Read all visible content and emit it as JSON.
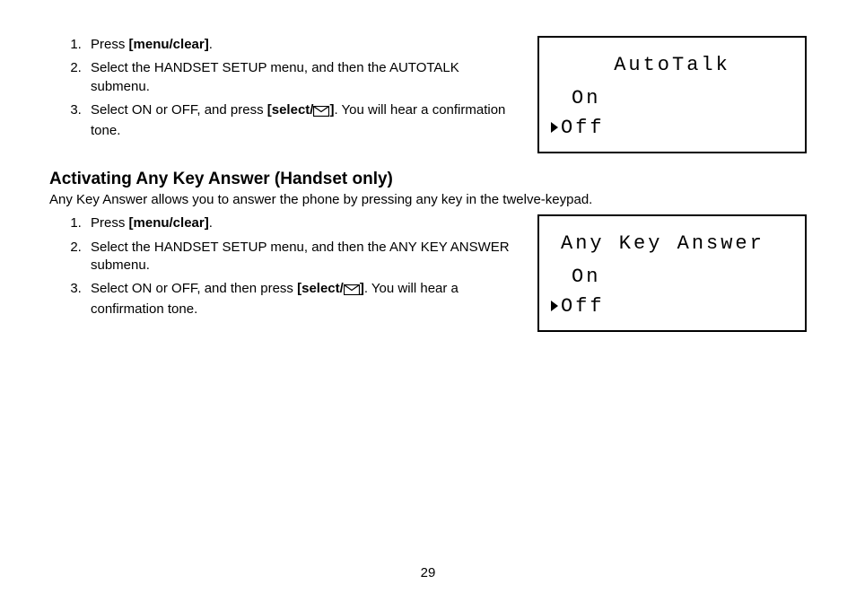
{
  "page_number": "29",
  "section1": {
    "steps": [
      {
        "prefix": "Press ",
        "bold": "[menu/clear]",
        "suffix": "."
      },
      {
        "text": "Select the HANDSET SETUP menu, and then the AUTOTALK submenu."
      },
      {
        "prefix": "Select ON or OFF, and press ",
        "bold_open": "[select/",
        "bold_close": "]",
        "suffix": ". You will hear a confirmation tone."
      }
    ],
    "lcd": {
      "title": "AutoTalk",
      "option1": "On",
      "option2": "Off"
    }
  },
  "section2": {
    "heading": "Activating Any Key Answer (Handset only)",
    "description": "Any Key Answer allows you to answer the phone by pressing any key in the twelve-keypad.",
    "steps": [
      {
        "prefix": "Press ",
        "bold": "[menu/clear]",
        "suffix": "."
      },
      {
        "text": "Select the HANDSET SETUP menu, and then the ANY KEY ANSWER submenu."
      },
      {
        "prefix": "Select ON or OFF, and then press ",
        "bold_open": "[select/",
        "bold_close": "]",
        "suffix": ". You will hear a confirmation tone."
      }
    ],
    "lcd": {
      "title": "Any Key Answer",
      "option1": "On",
      "option2": "Off"
    }
  }
}
